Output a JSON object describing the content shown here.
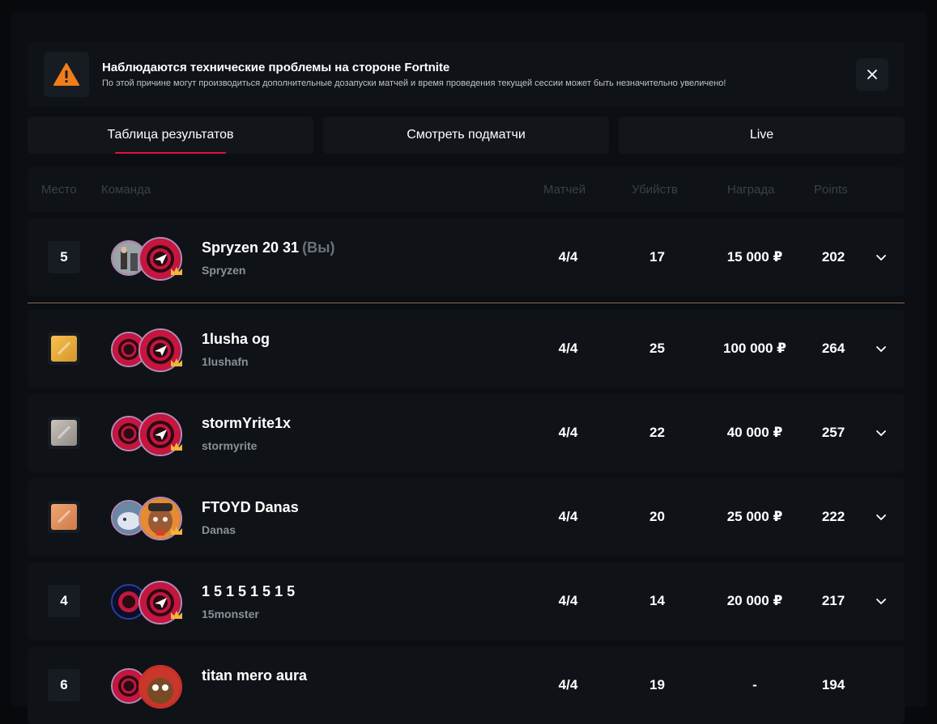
{
  "alert": {
    "title": "Наблюдаются технические проблемы на стороне Fortnite",
    "text": "По этой причине могут производиться дополнительные дозапуски матчей и время проведения текущей сессии может быть незначительно увеличено!",
    "icon": "warning-icon",
    "close_icon": "close-icon"
  },
  "tabs": [
    {
      "label": "Таблица результатов",
      "active": true
    },
    {
      "label": "Смотреть подматчи",
      "active": false
    },
    {
      "label": "Live",
      "active": false
    }
  ],
  "table": {
    "headers": {
      "place": "Место",
      "team": "Команда",
      "matches": "Матчей",
      "kills": "Убийств",
      "prize": "Награда",
      "points": "Points"
    }
  },
  "my_row": {
    "rank": "5",
    "name": "Spryzen 20 31",
    "you_tag": "(Вы)",
    "sub": "Spryzen",
    "matches": "4/4",
    "kills": "17",
    "prize": "15 000 ₽",
    "points": "202"
  },
  "rows": [
    {
      "rank": "1",
      "medal": "gold",
      "name": "1lusha og",
      "sub": "1lushafn",
      "matches": "4/4",
      "kills": "25",
      "prize": "100 000 ₽",
      "points": "264"
    },
    {
      "rank": "2",
      "medal": "silver",
      "name": "stormYrite1x",
      "sub": "stormyrite",
      "matches": "4/4",
      "kills": "22",
      "prize": "40 000 ₽",
      "points": "257"
    },
    {
      "rank": "3",
      "medal": "bronze",
      "name": "FTOYD Danas",
      "sub": "Danas",
      "matches": "4/4",
      "kills": "20",
      "prize": "25 000 ₽",
      "points": "222"
    },
    {
      "rank": "4",
      "medal": "",
      "name": "1 5 1 5 1 5 1 5",
      "sub": "15monster",
      "matches": "4/4",
      "kills": "14",
      "prize": "20 000 ₽",
      "points": "217"
    },
    {
      "rank": "6",
      "medal": "",
      "name": "titan mero aura",
      "sub": "",
      "matches": "4/4",
      "kills": "19",
      "prize": "-",
      "points": "194"
    }
  ],
  "colors": {
    "accent": "#e5123c",
    "warning": "#f07d1a",
    "gold": "#e9ae3b",
    "silver": "#aba69f",
    "bronze": "#e08d5b",
    "avatar_ring": "#b889b8",
    "avatar_red": "#c4163f"
  }
}
